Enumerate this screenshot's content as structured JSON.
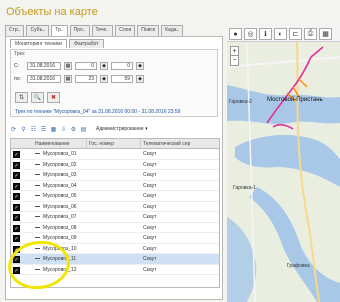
{
  "window": {
    "title": "Объекты на карте"
  },
  "tabs": [
    "Стр..",
    "Субъ..",
    "Тр..",
    "Про..",
    "Тече..",
    "Слои",
    "Поиск",
    "Када.."
  ],
  "subtabs": [
    "Мониторинг техники",
    "Фактработ"
  ],
  "period": {
    "legend": "Трек",
    "from_label": "С:",
    "from_date": "31.08.2016",
    "from_hour": "0",
    "from_min": "0",
    "to_label": "по:",
    "to_date": "31.08.2016",
    "to_hour": "23",
    "to_min": "59",
    "track_text": "Трек по технике \"Мусоровоз_04\" за 31.08.2016 00:00 - 31.08.2016 23:59"
  },
  "toolbar": {
    "admin_label": "Администрирование"
  },
  "table": {
    "columns": [
      "Наименование",
      "Гос. номер",
      "Телематический сер"
    ],
    "rows": [
      {
        "name": "Мусоровоз_01",
        "service": "Скаут",
        "selected": false
      },
      {
        "name": "Мусоровоз_02",
        "service": "Скаут",
        "selected": false
      },
      {
        "name": "Мусоровоз_03",
        "service": "Скаут",
        "selected": false
      },
      {
        "name": "Мусоровоз_04",
        "service": "Скаут",
        "selected": false
      },
      {
        "name": "Мусоровоз_05",
        "service": "Скаут",
        "selected": false
      },
      {
        "name": "Мусоровоз_06",
        "service": "Скаут",
        "selected": false
      },
      {
        "name": "Мусоровоз_07",
        "service": "Скаут",
        "selected": false
      },
      {
        "name": "Мусоровоз_08",
        "service": "Скаут",
        "selected": false
      },
      {
        "name": "Мусоровоз_09",
        "service": "Скаут",
        "selected": false
      },
      {
        "name": "Мусоровоз_10",
        "service": "Скаут",
        "selected": false
      },
      {
        "name": "Мусоровоз_11",
        "service": "Скаут",
        "selected": true
      },
      {
        "name": "Мусоровоз_12",
        "service": "Скаут",
        "selected": false
      }
    ]
  },
  "map": {
    "labels": [
      "Мостовой-Пристань",
      "Гаровка-2",
      "Гаровка-1",
      "Графовка"
    ]
  },
  "colors": {
    "title": "#c79a1f",
    "selected_row": "#cfe0f4",
    "highlight": "#f2e600",
    "water": "#a9c8e8",
    "track": "#e0309a"
  }
}
